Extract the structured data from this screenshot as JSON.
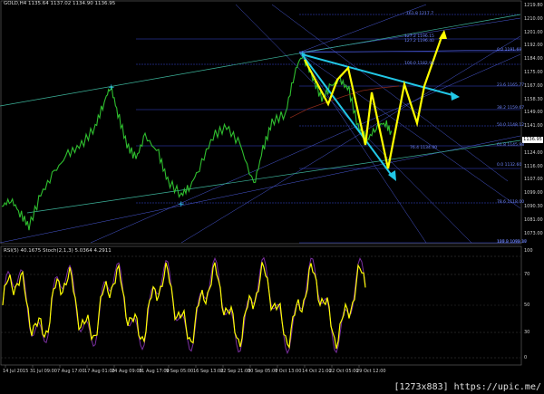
{
  "chart": {
    "header": "GOLD,H4  1135.64 1137.02 1134.90 1136.95",
    "current_price": "1136.95",
    "price_axis": [
      "1219.80",
      "1210.00",
      "1201.00",
      "1192.00",
      "1184.00",
      "1175.00",
      "1167.00",
      "1158.30",
      "1149.00",
      "1141.00",
      "1132.00",
      "1124.00",
      "1116.00",
      "1107.00",
      "1099.00",
      "1090.30",
      "1081.00",
      "1073.00"
    ],
    "fib_labels": [
      "161.8 1217.7",
      "127.2 1196.15",
      "127.2 1196.40",
      "0.0 1191.69",
      "100.0 1182.94",
      "23.6 1165.77",
      "38.2 1159.67",
      "50.0 1148.12",
      "61.8 1145.98",
      "76.4 1134.00",
      "0.0 1132.60",
      "78.6 1118.00",
      "100.0 1099.37",
      "127.2 1072.10"
    ],
    "time_axis": [
      "14 Jul 2015",
      "31 Jul 09:00",
      "7 Aug 17:00",
      "17 Aug 01:00",
      "24 Aug 09:00",
      "31 Aug 17:00",
      "9 Sep 05:00",
      "16 Sep 13:00",
      "22 Sep 21:00",
      "30 Sep 05:00",
      "7 Oct 13:00",
      "14 Oct 21:00",
      "22 Oct 05:00",
      "29 Oct 12:00"
    ],
    "colors": {
      "price": "#2fbf2f",
      "zigzag": "#ffff00",
      "arrow": "#22c7e6",
      "channel": "#3cb39a",
      "fib": "#3a4bd8",
      "rsi": "#ffff00",
      "stoch": "#7a2fa0"
    }
  },
  "indicator": {
    "header": "RSI(5) 40.1675  Stoch(2,1,3) 5.0364 4.2911",
    "levels": [
      "100",
      "70",
      "50",
      "30",
      "0"
    ]
  },
  "watermark": "[1273x883] https://upic.me/"
}
